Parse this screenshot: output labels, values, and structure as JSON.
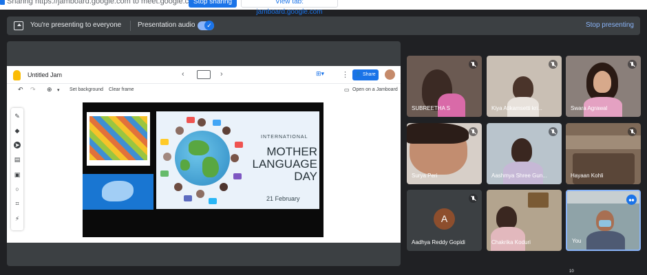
{
  "share_bar": {
    "text": "Sharing https://jamboard.google.com to meet.google.com",
    "stop_sharing_label": "Stop sharing",
    "view_tab_label": "View tab: jamboard.google.com"
  },
  "presenting_bar": {
    "status_text": "You're presenting to everyone",
    "audio_label": "Presentation audio",
    "audio_on": true,
    "stop_label": "Stop presenting"
  },
  "jamboard": {
    "title": "Untitled Jam",
    "share_label": "Share",
    "toolbar": {
      "set_background": "Set background",
      "clear_frame": "Clear frame",
      "open_on_jamboard": "Open on a Jamboard"
    },
    "tools": [
      "pen-icon",
      "eraser-icon",
      "select-icon",
      "sticky-note-icon",
      "image-icon",
      "circle-icon",
      "text-box-icon",
      "laser-icon"
    ]
  },
  "slide": {
    "line1": "INTERNATIONAL",
    "line2": "MOTHER",
    "line3": "LANGUAGE",
    "line4": "DAY",
    "date": "21 February"
  },
  "participants": [
    {
      "name": "SUBREETHA S",
      "muted": true
    },
    {
      "name": "Kiya Atikamsetti kri...",
      "muted": true
    },
    {
      "name": "Swara Agrawal",
      "muted": true
    },
    {
      "name": "Surya Peri",
      "muted": true
    },
    {
      "name": "Aashmya Shree Gun...",
      "muted": true
    },
    {
      "name": "Hayaan Kohli",
      "muted": true
    },
    {
      "name": "Aadhya Reddy Gopidi",
      "muted": true,
      "initial": "A"
    },
    {
      "name": "Chakrika Koduri",
      "muted": false
    },
    {
      "name": "You",
      "muted": false,
      "speaking": true
    }
  ],
  "participant_count": "10",
  "colors": {
    "accent": "#1a73e8",
    "meet_bg": "#202124",
    "tile_bg": "#3c4043"
  }
}
